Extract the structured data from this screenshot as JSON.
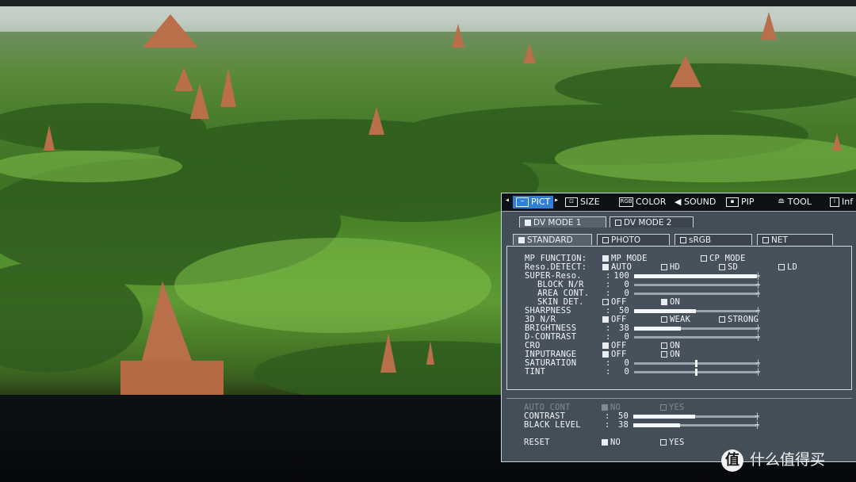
{
  "top_menu": [
    {
      "label": "PICT",
      "active": true,
      "icon": "picture-icon"
    },
    {
      "label": "SIZE",
      "active": false,
      "icon": "size-icon"
    },
    {
      "label": "COLOR",
      "active": false,
      "icon": "rgb-color-icon"
    },
    {
      "label": "SOUND",
      "active": false,
      "icon": "speaker-icon"
    },
    {
      "label": "PIP",
      "active": false,
      "icon": "pip-icon"
    },
    {
      "label": "TOOL",
      "active": false,
      "icon": "tool-icon"
    },
    {
      "label": "Inf",
      "active": false,
      "icon": "info-icon"
    }
  ],
  "mode_tabs": [
    {
      "label": "DV MODE 1",
      "active": true
    },
    {
      "label": "DV MODE 2",
      "active": false
    }
  ],
  "preset_tabs": [
    {
      "label": "STANDARD",
      "active": true
    },
    {
      "label": "PHOTO",
      "active": false
    },
    {
      "label": "sRGB",
      "active": false
    },
    {
      "label": "NET",
      "active": false
    }
  ],
  "settings": {
    "mp_function": {
      "label": "MP FUNCTION:",
      "opt1": "MP MODE",
      "opt2": "CP MODE",
      "selected": "MP MODE"
    },
    "reso_detect": {
      "label": "Reso.DETECT:",
      "opt1": "AUTO",
      "opt2": "HD",
      "opt3": "SD",
      "opt4": "LD",
      "selected": "AUTO"
    },
    "super_reso": {
      "label": "SUPER-Reso.",
      "colon": ":",
      "value": "100",
      "level": 1.0
    },
    "block_nr": {
      "label": "BLOCK N/R",
      "colon": ":",
      "value": "0",
      "level": 0
    },
    "area_cont": {
      "label": "AREA CONT.",
      "colon": ":",
      "value": "0",
      "level": 0
    },
    "skin_det": {
      "label": "SKIN DET.",
      "colon": ":",
      "opt1": "OFF",
      "opt2": "ON",
      "selected": "ON"
    },
    "sharpness": {
      "label": "SHARPNESS",
      "colon": ":",
      "value": "50",
      "level": 0.5
    },
    "nr_3d": {
      "label": "3D N/R",
      "colon": ":",
      "opt1": "OFF",
      "opt2": "WEAK",
      "opt3": "STRONG",
      "selected": "OFF"
    },
    "brightness": {
      "label": "BRIGHTNESS",
      "colon": ":",
      "value": "38",
      "level": 0.38
    },
    "d_contrast": {
      "label": "D-CONTRAST",
      "colon": ":",
      "value": "0",
      "level": 0
    },
    "cro": {
      "label": "CRO",
      "colon": ":",
      "opt1": "OFF",
      "opt2": "ON",
      "selected": "OFF"
    },
    "inputrange": {
      "label": "INPUTRANGE",
      "colon": ":",
      "opt1": "OFF",
      "opt2": "ON",
      "selected": "OFF"
    },
    "saturation": {
      "label": "SATURATION",
      "colon": ":",
      "value": "0",
      "level": 0.5
    },
    "tint": {
      "label": "TINT",
      "colon": ":",
      "value": "0",
      "level": 0.5
    },
    "auto_cont": {
      "label": "AUTO CONT",
      "colon": ":",
      "opt1": "NO",
      "opt2": "YES",
      "selected": "NO"
    },
    "contrast": {
      "label": "CONTRAST",
      "colon": ":",
      "value": "50",
      "level": 0.5
    },
    "black_level": {
      "label": "BLACK LEVEL",
      "colon": ":",
      "value": "38",
      "level": 0.38
    },
    "reset": {
      "label": "RESET",
      "colon": ":",
      "opt1": "NO",
      "opt2": "YES",
      "selected": "NO"
    }
  },
  "watermark": {
    "icon_char": "值",
    "text": "什么值得买"
  }
}
